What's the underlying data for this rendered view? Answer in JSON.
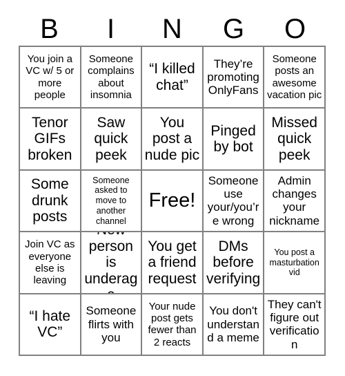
{
  "card": {
    "title_letters": [
      "B",
      "I",
      "N",
      "G",
      "O"
    ],
    "rows": [
      [
        {
          "text": "You join a VC w/ 5 or more people",
          "size": "sm"
        },
        {
          "text": "Someone complains about insomnia",
          "size": "sm"
        },
        {
          "text": "“I killed chat”",
          "size": "lg"
        },
        {
          "text": "They’re promoting OnlyFans",
          "size": "md"
        },
        {
          "text": "Someone posts an awesome vacation pic",
          "size": "sm"
        }
      ],
      [
        {
          "text": "Tenor GIFs broken",
          "size": "lg"
        },
        {
          "text": "Saw quick peek",
          "size": "lg"
        },
        {
          "text": "You post a nude pic",
          "size": "lg"
        },
        {
          "text": "Pinged by bot",
          "size": "lg"
        },
        {
          "text": "Missed quick peek",
          "size": "lg"
        }
      ],
      [
        {
          "text": "Some drunk posts",
          "size": "lg"
        },
        {
          "text": "Someone asked to move to another channel",
          "size": "xs"
        },
        {
          "text": "Free!",
          "size": "xl"
        },
        {
          "text": "Someone use your/you’re wrong",
          "size": "md"
        },
        {
          "text": "Admin changes your nickname",
          "size": "md"
        }
      ],
      [
        {
          "text": "Join VC as everyone else is leaving",
          "size": "sm"
        },
        {
          "text": "New person is underage",
          "size": "lg"
        },
        {
          "text": "You get a friend request",
          "size": "lg"
        },
        {
          "text": "DMs before verifying",
          "size": "lg"
        },
        {
          "text": "You post a masturbation vid",
          "size": "xs"
        }
      ],
      [
        {
          "text": "“I hate VC”",
          "size": "lg"
        },
        {
          "text": "Someone flirts with you",
          "size": "md"
        },
        {
          "text": "Your nude post gets fewer than 2 reacts",
          "size": "sm"
        },
        {
          "text": "You don't understand a meme",
          "size": "md"
        },
        {
          "text": "They can't figure out verification",
          "size": "md"
        }
      ]
    ]
  }
}
